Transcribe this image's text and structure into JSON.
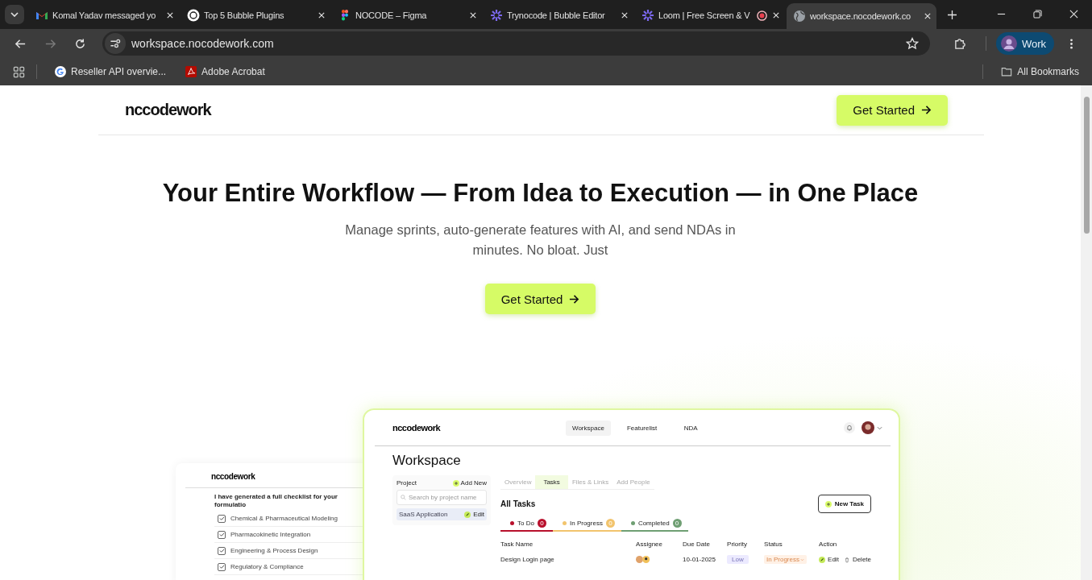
{
  "browser": {
    "tabs": [
      {
        "title": "Komal Yadav messaged yo",
        "kind": "mail",
        "selected": false,
        "recording": false
      },
      {
        "title": "Top 5 Bubble Plugins",
        "kind": "chat",
        "selected": false,
        "recording": false
      },
      {
        "title": "NOCODE – Figma",
        "kind": "figma",
        "selected": false,
        "recording": false
      },
      {
        "title": "Trynocode | Bubble Editor",
        "kind": "burst",
        "selected": false,
        "recording": false
      },
      {
        "title": "Loom | Free Screen & V",
        "kind": "burst",
        "selected": false,
        "recording": true
      },
      {
        "title": "workspace.nocodework.co",
        "kind": "globe",
        "selected": true,
        "recording": false
      }
    ],
    "address": "workspace.nocodework.com",
    "profile": "Work",
    "bookmarks": [
      {
        "label": "Reseller API overvie...",
        "kind": "google"
      },
      {
        "label": "Adobe Acrobat",
        "kind": "pdf"
      }
    ],
    "all_bookmarks": "All Bookmarks"
  },
  "page": {
    "logo": "nccodework",
    "header_button": "Get Started",
    "headline": "Your Entire Workflow — From Idea to Execution — in One Place",
    "subtitle": "Manage sprints, auto-generate features with AI, and send NDAs in minutes. No bloat. Just",
    "cta": "Get Started",
    "back_card": {
      "logo": "nccodework",
      "message": "I have generated a full checklist for your formulatio",
      "checklist": [
        {
          "label": "Chemical & Pharmaceutical Modeling",
          "checked": true
        },
        {
          "label": "Pharmacokinetic Integration",
          "checked": true
        },
        {
          "label": "Engineering & Process Design",
          "checked": true
        },
        {
          "label": "Regulatory & Compliance",
          "checked": true
        }
      ]
    },
    "front_card": {
      "logo": "nccodework",
      "nav": [
        {
          "label": "Workspace",
          "selected": true
        },
        {
          "label": "Featurelist",
          "selected": false
        },
        {
          "label": "NDA",
          "selected": false
        }
      ],
      "title": "Workspace",
      "project_heading": "Project",
      "add_new": "Add New",
      "search": {
        "placeholder": "Search by project name"
      },
      "projects": [
        {
          "name": "SaaS Application",
          "selected": true,
          "action": "Edit"
        }
      ],
      "tabs": [
        {
          "label": "Overview",
          "selected": false
        },
        {
          "label": "Tasks",
          "selected": true
        },
        {
          "label": "Files & Links",
          "selected": false
        },
        {
          "label": "Add People",
          "selected": false
        }
      ],
      "section_title": "All Tasks",
      "new_task": "New Task",
      "status_tabs": [
        {
          "label": "To Do",
          "count": "0",
          "color": "#b8102c"
        },
        {
          "label": "In Progress",
          "count": "0",
          "color": "#f2c46d"
        },
        {
          "label": "Completed",
          "count": "0",
          "color": "#6f9f73"
        }
      ],
      "columns": [
        "Task Name",
        "Assignee",
        "Due Date",
        "Priority",
        "Status",
        "Action"
      ],
      "rows": [
        {
          "task": "Design Login page",
          "due": "10-01-2025",
          "priority": "Low",
          "status": "In Progress",
          "edit": "Edit",
          "delete": "Delete"
        }
      ]
    }
  }
}
